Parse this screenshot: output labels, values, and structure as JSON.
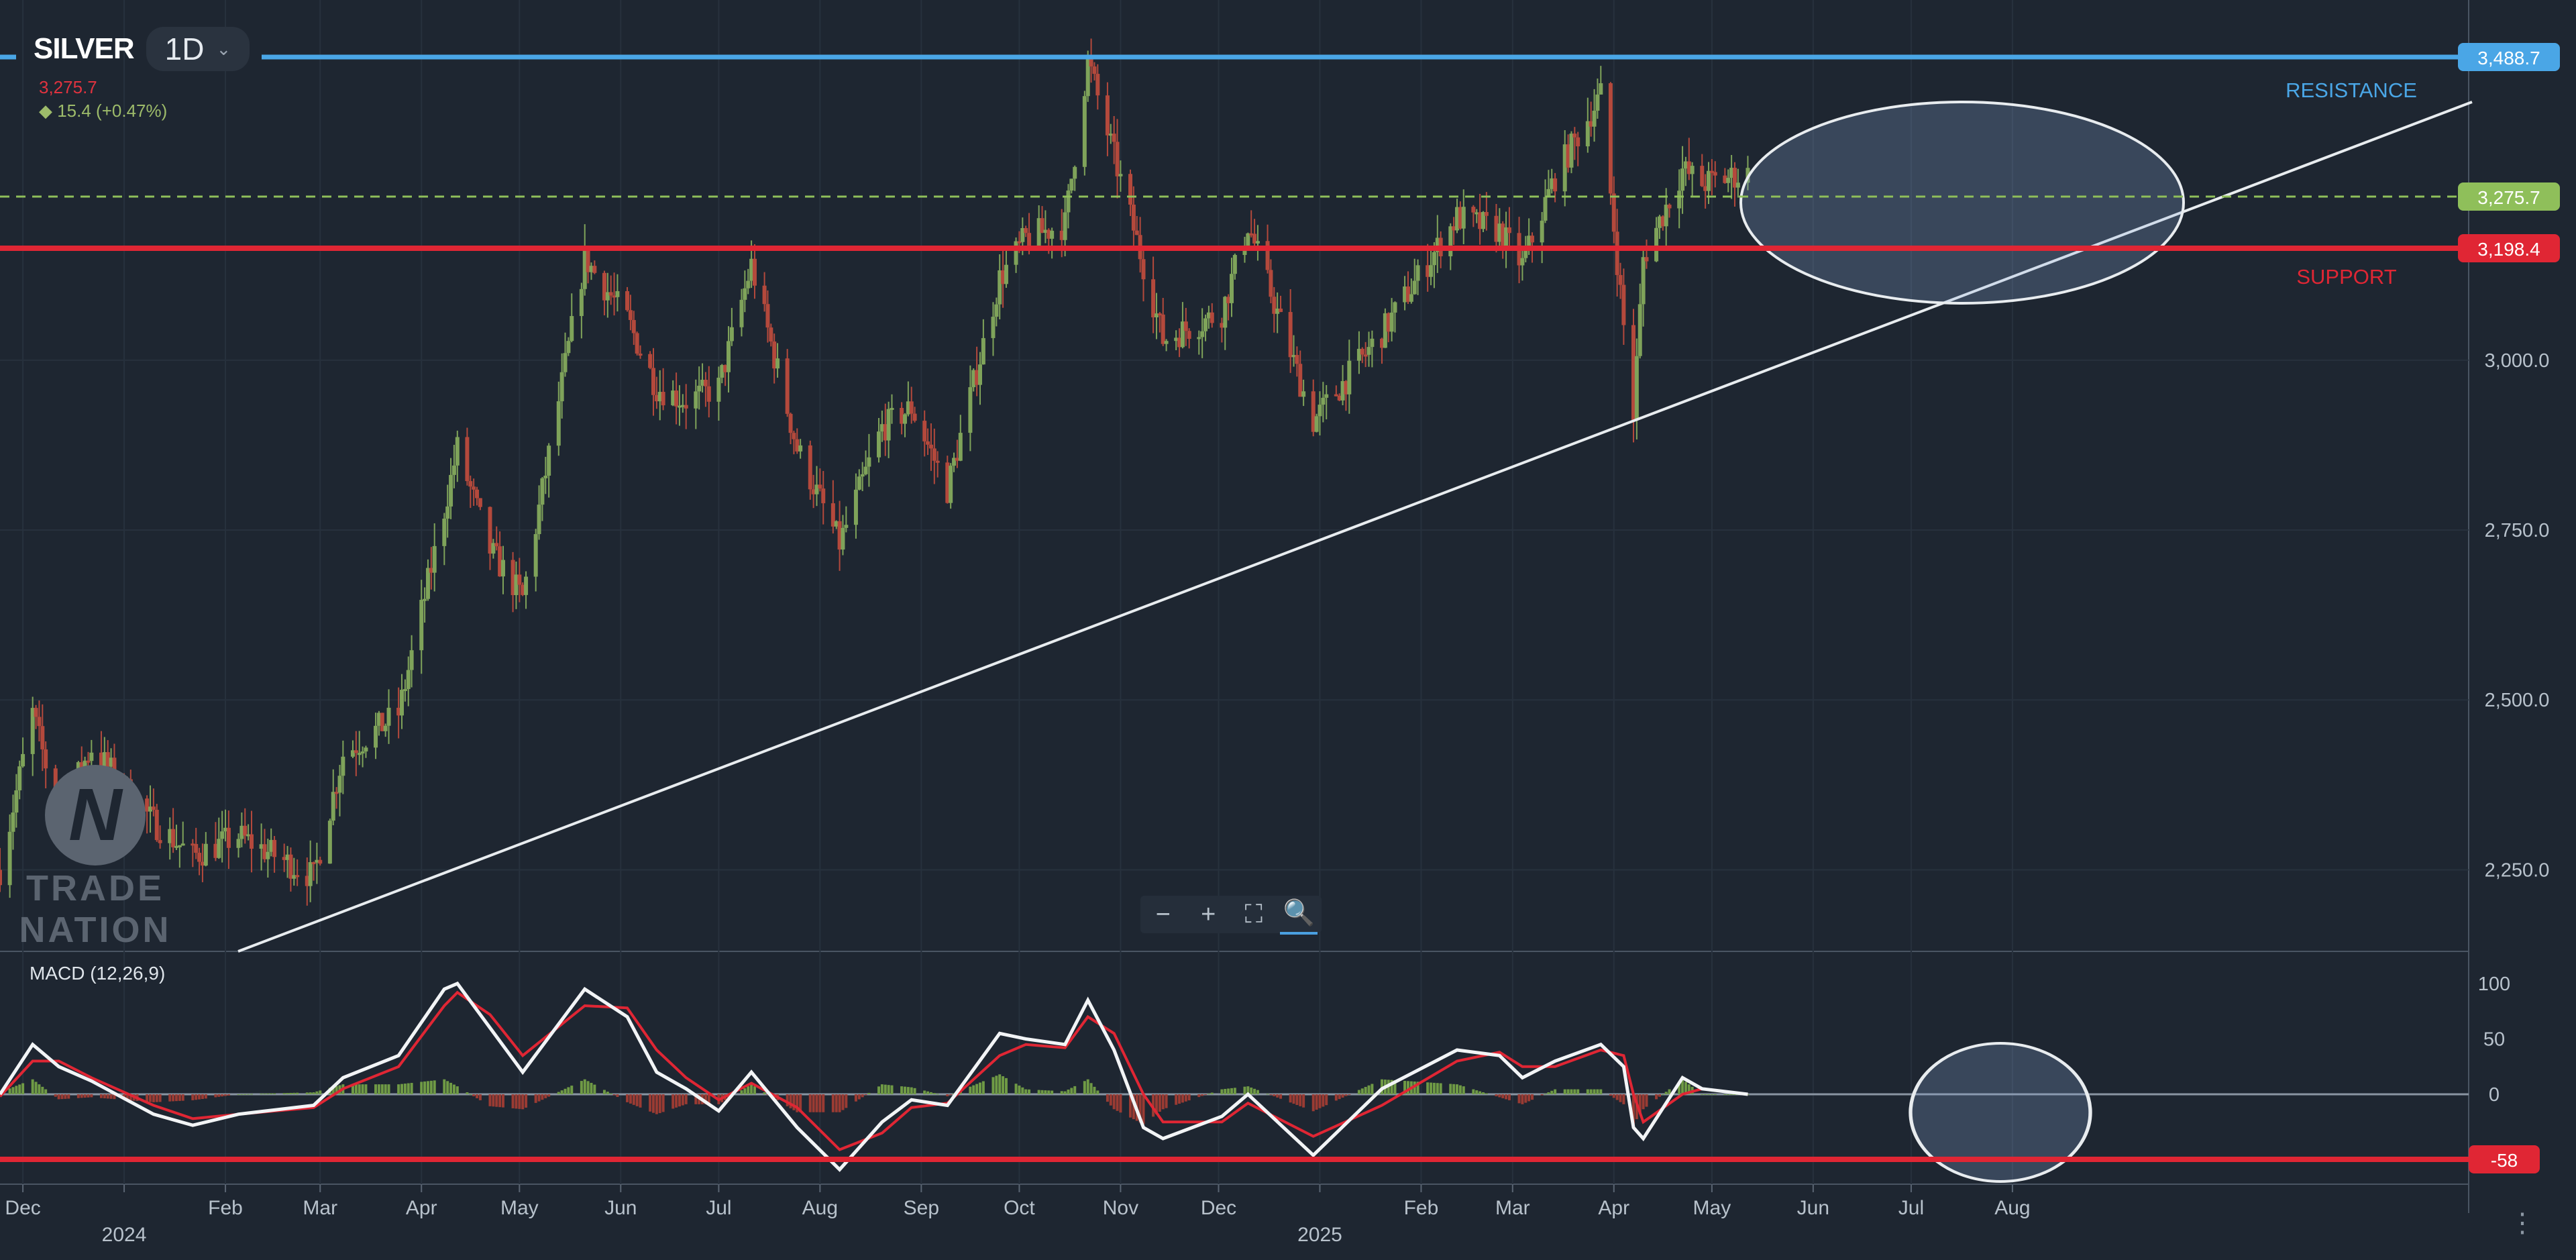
{
  "header": {
    "symbol": "SILVER",
    "timeframe": "1D",
    "last_price": "3,275.7",
    "change": "15.4 (+0.47%)"
  },
  "annotations": {
    "resistance_label": "RESISTANCE",
    "support_label": "SUPPORT"
  },
  "zoom_controls": [
    "−",
    "+",
    "⛶",
    "🔍"
  ],
  "watermark": {
    "line1": "TRADE",
    "line2": "NATION"
  },
  "price_badges": {
    "resistance": "3,488.7",
    "current": "3,275.7",
    "support": "3,198.4",
    "macd_level": "-58"
  },
  "colors": {
    "background": "#1e2631",
    "resistance": "#4aa6e6",
    "support": "#e02634",
    "current": "#8fbf5a",
    "trendline": "#e8ecef",
    "candle_up": "#7fa35a",
    "candle_down": "#b4493c",
    "macd_line": "#f2f4f6",
    "signal_line": "#e02634"
  },
  "chart_data": [
    {
      "type": "candlestick",
      "title": "SILVER 1D",
      "x_tick_labels": [
        "Dec",
        "2024",
        "Feb",
        "Mar",
        "Apr",
        "May",
        "Jun",
        "Jul",
        "Aug",
        "Sep",
        "Oct",
        "Nov",
        "Dec",
        "2025",
        "Feb",
        "Mar",
        "Apr",
        "May",
        "Jun",
        "Jul",
        "Aug"
      ],
      "y_tick_labels": [
        "2,250.0",
        "2,500.0",
        "2,750.0",
        "3,000.0"
      ],
      "ylim": [
        2130,
        3530
      ],
      "y_ticks": [
        2250,
        2500,
        2750,
        3000
      ],
      "close_path": [
        [
          "2023-11-24",
          2250
        ],
        [
          "2023-12-04",
          2480
        ],
        [
          "2023-12-12",
          2330
        ],
        [
          "2023-12-22",
          2430
        ],
        [
          "2024-01-10",
          2320
        ],
        [
          "2024-01-22",
          2270
        ],
        [
          "2024-02-05",
          2300
        ],
        [
          "2024-02-28",
          2240
        ],
        [
          "2024-03-08",
          2420
        ],
        [
          "2024-03-25",
          2480
        ],
        [
          "2024-04-08",
          2780
        ],
        [
          "2024-04-12",
          2870
        ],
        [
          "2024-04-22",
          2720
        ],
        [
          "2024-05-02",
          2650
        ],
        [
          "2024-05-21",
          3150
        ],
        [
          "2024-06-03",
          3060
        ],
        [
          "2024-06-12",
          2960
        ],
        [
          "2024-06-21",
          2940
        ],
        [
          "2024-07-01",
          2960
        ],
        [
          "2024-07-11",
          3140
        ],
        [
          "2024-07-25",
          2870
        ],
        [
          "2024-08-07",
          2730
        ],
        [
          "2024-08-20",
          2900
        ],
        [
          "2024-08-29",
          2930
        ],
        [
          "2024-09-09",
          2810
        ],
        [
          "2024-09-25",
          3120
        ],
        [
          "2024-10-03",
          3180
        ],
        [
          "2024-10-15",
          3200
        ],
        [
          "2024-10-22",
          3440
        ],
        [
          "2024-10-30",
          3300
        ],
        [
          "2024-11-08",
          3140
        ],
        [
          "2024-11-14",
          3030
        ],
        [
          "2024-12-02",
          3070
        ],
        [
          "2024-12-10",
          3200
        ],
        [
          "2024-12-30",
          2910
        ],
        [
          "2025-01-20",
          3040
        ],
        [
          "2025-02-12",
          3210
        ],
        [
          "2025-02-25",
          3190
        ],
        [
          "2025-03-04",
          3140
        ],
        [
          "2025-03-14",
          3270
        ],
        [
          "2025-03-28",
          3390
        ],
        [
          "2025-04-04",
          3050
        ],
        [
          "2025-04-07",
          2920
        ],
        [
          "2025-04-10",
          3150
        ],
        [
          "2025-04-22",
          3280
        ],
        [
          "2025-04-28",
          3260
        ],
        [
          "2025-05-12",
          3275
        ]
      ],
      "high_labels": [
        "3,488.7"
      ],
      "resistance": 3488.7,
      "support": 3198.4,
      "last": 3275.7,
      "trendline": {
        "from": [
          "2024-01-20",
          2130
        ],
        "to": [
          "2025-06-10",
          3440
        ]
      },
      "annotations": [
        "RESISTANCE",
        "SUPPORT",
        "ellipse around Mar-May 2025 price action",
        "rising trendline"
      ]
    },
    {
      "type": "line",
      "title": "MACD (12,26,9)",
      "y_tick_labels": [
        "100",
        "50",
        "0"
      ],
      "ylim": [
        -75,
        115
      ],
      "y_ticks": [
        100,
        50,
        0
      ],
      "series": [
        {
          "values": [
            [
              "2023-11-24",
              0
            ],
            [
              "2023-12-04",
              45
            ],
            [
              "2023-12-12",
              25
            ],
            [
              "2023-12-22",
              12
            ],
            [
              "2024-01-10",
              -18
            ],
            [
              "2024-01-22",
              -28
            ],
            [
              "2024-02-05",
              -18
            ],
            [
              "2024-02-28",
              -10
            ],
            [
              "2024-03-08",
              15
            ],
            [
              "2024-03-25",
              35
            ],
            [
              "2024-04-08",
              95
            ],
            [
              "2024-04-12",
              100
            ],
            [
              "2024-04-22",
              60
            ],
            [
              "2024-05-02",
              20
            ],
            [
              "2024-05-21",
              95
            ],
            [
              "2024-06-03",
              70
            ],
            [
              "2024-06-12",
              20
            ],
            [
              "2024-06-21",
              5
            ],
            [
              "2024-07-01",
              -15
            ],
            [
              "2024-07-11",
              20
            ],
            [
              "2024-07-25",
              -30
            ],
            [
              "2024-08-07",
              -68
            ],
            [
              "2024-08-20",
              -25
            ],
            [
              "2024-08-29",
              -5
            ],
            [
              "2024-09-09",
              -10
            ],
            [
              "2024-09-25",
              55
            ],
            [
              "2024-10-03",
              50
            ],
            [
              "2024-10-15",
              45
            ],
            [
              "2024-10-22",
              85
            ],
            [
              "2024-10-30",
              40
            ],
            [
              "2024-11-08",
              -30
            ],
            [
              "2024-11-14",
              -40
            ],
            [
              "2024-12-02",
              -20
            ],
            [
              "2024-12-10",
              0
            ],
            [
              "2024-12-30",
              -55
            ],
            [
              "2025-01-20",
              5
            ],
            [
              "2025-02-12",
              40
            ],
            [
              "2025-02-25",
              35
            ],
            [
              "2025-03-04",
              15
            ],
            [
              "2025-03-14",
              30
            ],
            [
              "2025-03-28",
              45
            ],
            [
              "2025-04-04",
              25
            ],
            [
              "2025-04-07",
              -30
            ],
            [
              "2025-04-10",
              -40
            ],
            [
              "2025-04-22",
              15
            ],
            [
              "2025-04-28",
              5
            ],
            [
              "2025-05-12",
              0
            ]
          ]
        },
        {
          "values": [
            [
              "2023-11-24",
              -2
            ],
            [
              "2023-12-04",
              30
            ],
            [
              "2023-12-12",
              30
            ],
            [
              "2023-12-22",
              15
            ],
            [
              "2024-01-10",
              -10
            ],
            [
              "2024-01-22",
              -22
            ],
            [
              "2024-02-05",
              -18
            ],
            [
              "2024-02-28",
              -12
            ],
            [
              "2024-03-08",
              5
            ],
            [
              "2024-03-25",
              25
            ],
            [
              "2024-04-08",
              80
            ],
            [
              "2024-04-12",
              92
            ],
            [
              "2024-04-22",
              72
            ],
            [
              "2024-05-02",
              35
            ],
            [
              "2024-05-21",
              80
            ],
            [
              "2024-06-03",
              78
            ],
            [
              "2024-06-12",
              40
            ],
            [
              "2024-06-21",
              15
            ],
            [
              "2024-07-01",
              -5
            ],
            [
              "2024-07-11",
              10
            ],
            [
              "2024-07-25",
              -12
            ],
            [
              "2024-08-07",
              -50
            ],
            [
              "2024-08-20",
              -35
            ],
            [
              "2024-08-29",
              -12
            ],
            [
              "2024-09-09",
              -8
            ],
            [
              "2024-09-25",
              35
            ],
            [
              "2024-10-03",
              45
            ],
            [
              "2024-10-15",
              42
            ],
            [
              "2024-10-22",
              70
            ],
            [
              "2024-10-30",
              55
            ],
            [
              "2024-11-08",
              0
            ],
            [
              "2024-11-14",
              -25
            ],
            [
              "2024-12-02",
              -25
            ],
            [
              "2024-12-10",
              -8
            ],
            [
              "2024-12-30",
              -38
            ],
            [
              "2025-01-20",
              -10
            ],
            [
              "2025-02-12",
              30
            ],
            [
              "2025-02-25",
              38
            ],
            [
              "2025-03-04",
              25
            ],
            [
              "2025-03-14",
              25
            ],
            [
              "2025-03-28",
              40
            ],
            [
              "2025-04-04",
              35
            ],
            [
              "2025-04-07",
              0
            ],
            [
              "2025-04-10",
              -25
            ],
            [
              "2025-04-22",
              0
            ],
            [
              "2025-04-28",
              5
            ],
            [
              "2025-05-12",
              0
            ]
          ]
        }
      ],
      "histogram": "green/red bars around zero",
      "horizontal_level": -58,
      "annotations": [
        "ellipse around Apr-May 2025 MACD"
      ]
    }
  ]
}
